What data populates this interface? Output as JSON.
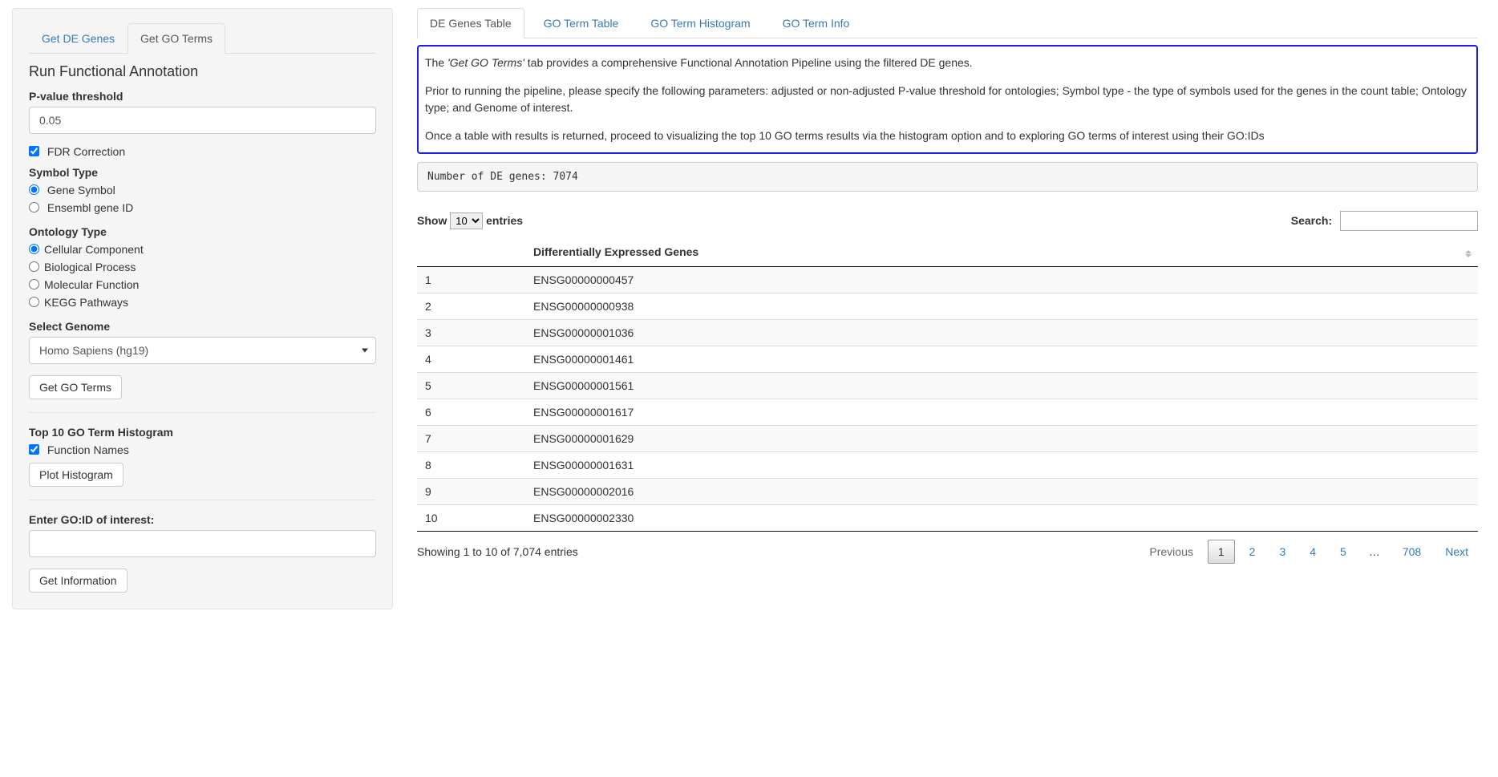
{
  "sidebar": {
    "tabs": {
      "de": "Get DE Genes",
      "go": "Get GO Terms"
    },
    "title": "Run Functional Annotation",
    "pvalue_label": "P-value threshold",
    "pvalue_value": "0.05",
    "fdr_label": "FDR Correction",
    "symbol_type_label": "Symbol Type",
    "symbol_options": {
      "gene_symbol": "Gene Symbol",
      "ensembl": "Ensembl gene ID"
    },
    "ontology_label": "Ontology Type",
    "ontology_options": {
      "cc": "Cellular Component",
      "bp": "Biological Process",
      "mf": "Molecular Function",
      "kegg": "KEGG Pathways"
    },
    "genome_label": "Select Genome",
    "genome_value": "Homo Sapiens (hg19)",
    "get_go_button": "Get GO Terms",
    "histogram_title": "Top 10 GO Term Histogram",
    "function_names_label": "Function Names",
    "plot_histogram_button": "Plot Histogram",
    "goid_label": "Enter GO:ID of interest:",
    "goid_value": "",
    "get_info_button": "Get Information"
  },
  "main": {
    "tabs": {
      "de_table": "DE Genes Table",
      "go_table": "GO Term Table",
      "go_hist": "GO Term Histogram",
      "go_info": "GO Term Info"
    },
    "info": {
      "p1a": "The ",
      "p1b_italic": "'Get GO Terms'",
      "p1c": " tab provides a comprehensive Functional Annotation Pipeline using the filtered DE genes.",
      "p2": "Prior to running the pipeline, please specify the following parameters: adjusted or non-adjusted P-value threshold for ontologies; Symbol type - the type of symbols used for the genes in the count table; Ontology type; and Genome of interest.",
      "p3": "Once a table with results is returned, proceed to visualizing the top 10 GO terms results via the histogram option and to exploring GO terms of interest using their GO:IDs"
    },
    "pre_text": "Number of DE genes: 7074",
    "length_prefix": "Show ",
    "length_value": "10",
    "length_suffix": " entries",
    "search_label": "Search:",
    "search_value": "",
    "col_header": "Differentially Expressed Genes",
    "rows": [
      {
        "n": "1",
        "gene": "ENSG00000000457"
      },
      {
        "n": "2",
        "gene": "ENSG00000000938"
      },
      {
        "n": "3",
        "gene": "ENSG00000001036"
      },
      {
        "n": "4",
        "gene": "ENSG00000001461"
      },
      {
        "n": "5",
        "gene": "ENSG00000001561"
      },
      {
        "n": "6",
        "gene": "ENSG00000001617"
      },
      {
        "n": "7",
        "gene": "ENSG00000001629"
      },
      {
        "n": "8",
        "gene": "ENSG00000001631"
      },
      {
        "n": "9",
        "gene": "ENSG00000002016"
      },
      {
        "n": "10",
        "gene": "ENSG00000002330"
      }
    ],
    "info_text": "Showing 1 to 10 of 7,074 entries",
    "paginate": {
      "previous": "Previous",
      "pages": [
        "1",
        "2",
        "3",
        "4",
        "5"
      ],
      "ellipsis": "…",
      "last": "708",
      "next": "Next"
    }
  }
}
